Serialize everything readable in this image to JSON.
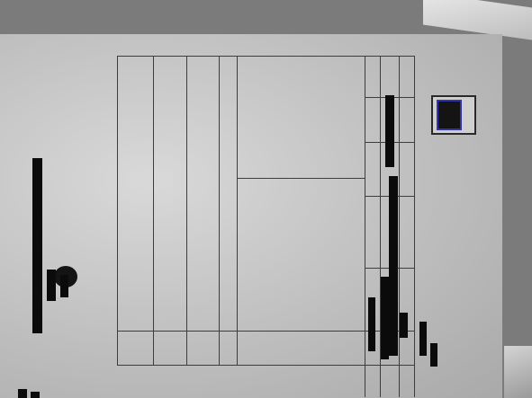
{
  "document": {
    "form_title": "",
    "redactions": 14
  }
}
